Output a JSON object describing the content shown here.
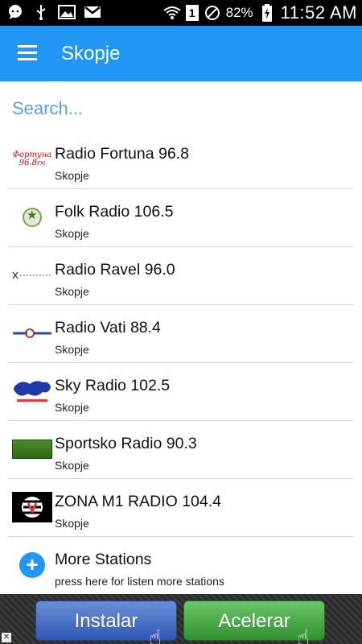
{
  "status": {
    "battery": "82%",
    "time": "11:52 AM",
    "sim_slot": "1"
  },
  "appbar": {
    "title": "Skopje"
  },
  "search": {
    "placeholder": "Search..."
  },
  "stations": [
    {
      "name": "Radio Fortuna 96.8",
      "city": "Skopje",
      "logo": "fortuna-logo"
    },
    {
      "name": "Folk Radio 106.5",
      "city": "Skopje",
      "logo": "folk-logo"
    },
    {
      "name": "Radio Ravel 96.0",
      "city": "Skopje",
      "logo": "ravel-logo"
    },
    {
      "name": "Radio Vati 88.4",
      "city": "Skopje",
      "logo": "vati-logo"
    },
    {
      "name": "Sky Radio 102.5",
      "city": "Skopje",
      "logo": "sky-logo"
    },
    {
      "name": "Sportsko Radio 90.3",
      "city": "Skopje",
      "logo": "sportsko-logo"
    },
    {
      "name": "ZONA M1 RADIO 104.4",
      "city": "Skopje",
      "logo": "zona-logo"
    }
  ],
  "more": {
    "title": "More Stations",
    "subtitle": "press here for listen more stations"
  },
  "ad": {
    "install_label": "Instalar",
    "accelerate_label": "Acelerar",
    "close": "✕"
  },
  "colors": {
    "primary": "#2196F3",
    "search_hint": "#5a9fd8"
  }
}
